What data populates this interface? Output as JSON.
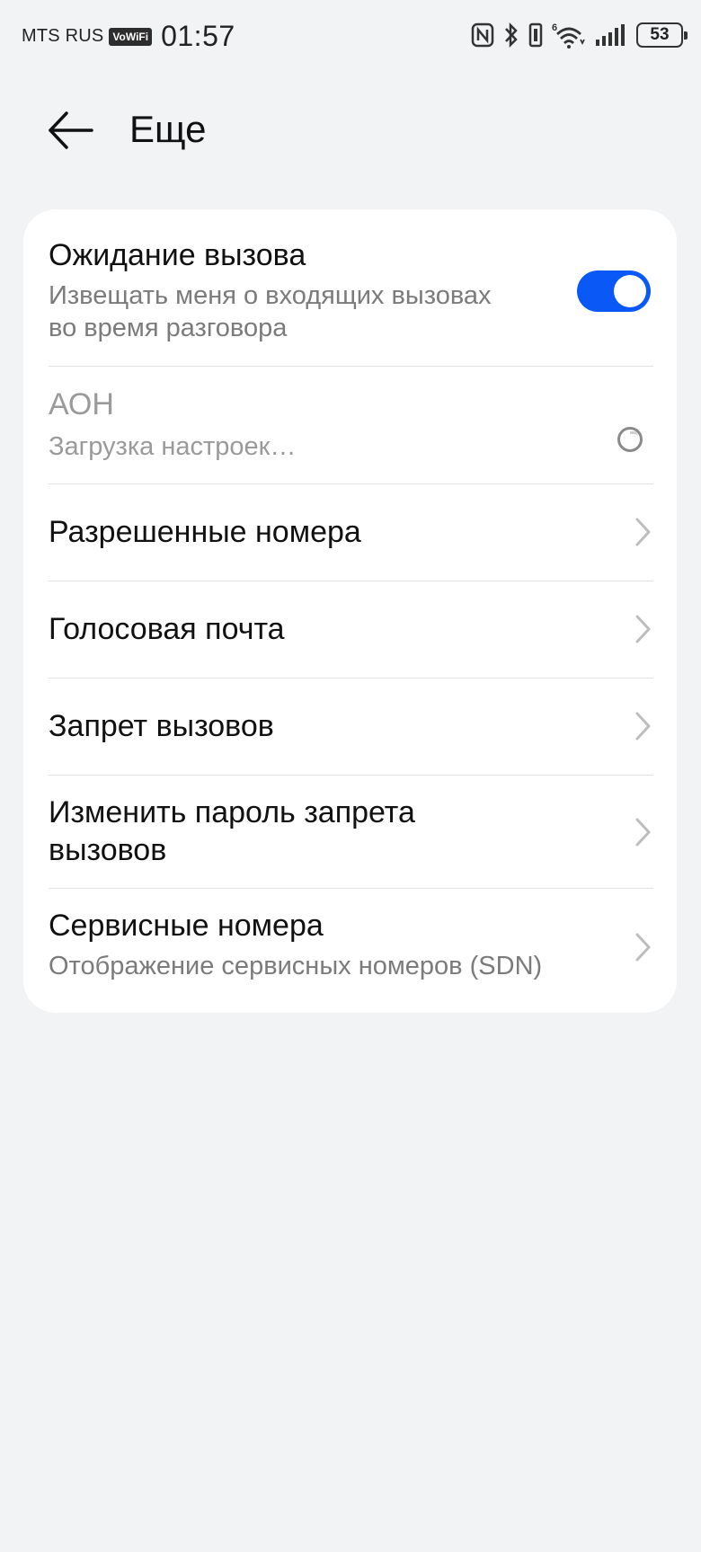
{
  "status_bar": {
    "carrier": "MTS RUS",
    "vowifi_badge": "VoWiFi",
    "time": "01:57",
    "network_label": "6",
    "battery_level": "53",
    "icons": [
      "nfc-icon",
      "bluetooth-icon",
      "vibrate-icon",
      "wifi-6-icon",
      "signal-icon",
      "battery-icon"
    ]
  },
  "header": {
    "title": "Еще",
    "back_icon": "arrow-left-icon"
  },
  "accent_color": "#0a59f7",
  "settings": {
    "call_waiting": {
      "title": "Ожидание вызова",
      "subtitle_line1": "Извещать меня о входящих вызовах",
      "subtitle_line2": "во время разговора",
      "enabled": true
    },
    "caller_id": {
      "title": "АОН",
      "subtitle": "Загрузка настроек…",
      "state": "loading"
    },
    "items": [
      {
        "title": "Разрешенные номера"
      },
      {
        "title": "Голосовая почта"
      },
      {
        "title": "Запрет вызовов"
      },
      {
        "title_line1": "Изменить пароль запрета",
        "title_line2": "вызовов"
      },
      {
        "title": "Сервисные номера",
        "subtitle": "Отображение сервисных номеров (SDN)"
      }
    ]
  }
}
